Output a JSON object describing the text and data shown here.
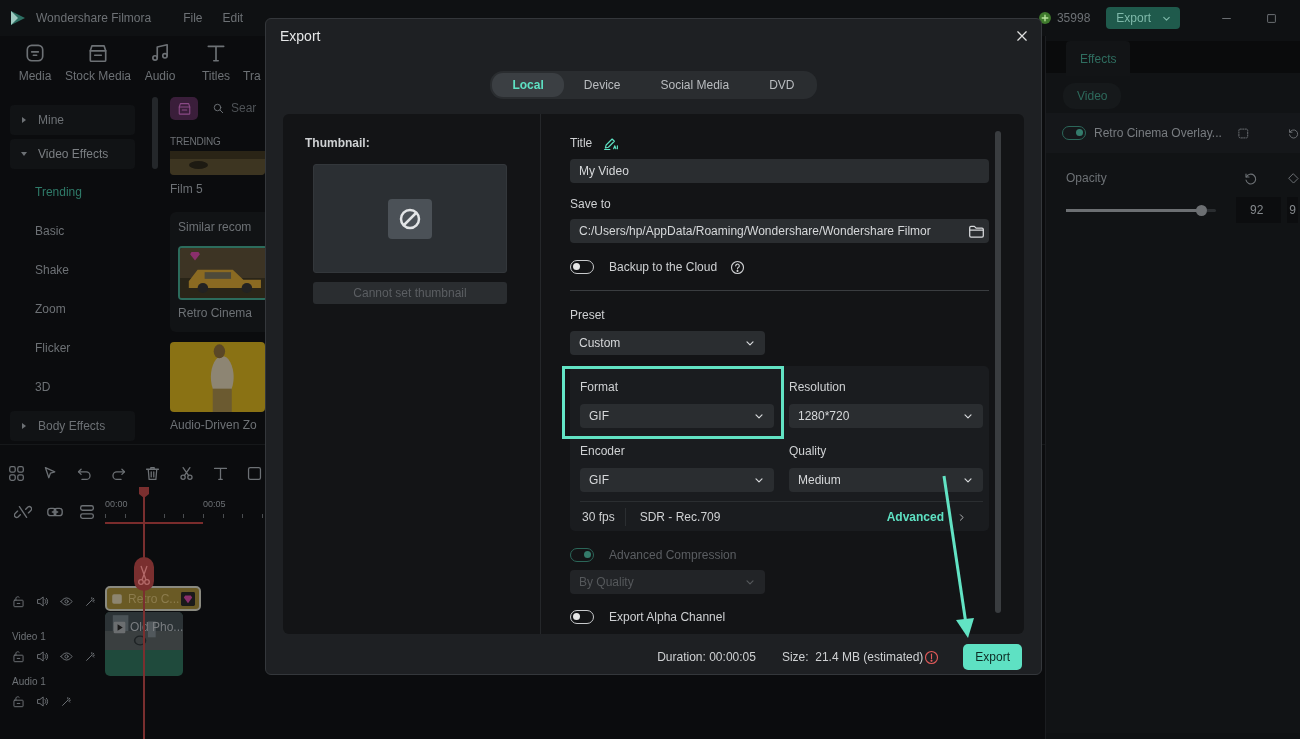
{
  "app": {
    "name": "Wondershare Filmora",
    "menu": [
      "File",
      "Edit"
    ],
    "coins": "35998",
    "export_button": "Export"
  },
  "toolbar": [
    {
      "label": "Media",
      "kind": "media"
    },
    {
      "label": "Stock Media",
      "kind": "store"
    },
    {
      "label": "Audio",
      "kind": "audio"
    },
    {
      "label": "Titles",
      "kind": "titles"
    },
    {
      "label": "Tra",
      "kind": "none"
    }
  ],
  "sidebar": {
    "items": [
      {
        "label": "Mine",
        "expanded": false
      },
      {
        "label": "Video Effects",
        "expanded": true,
        "children": [
          {
            "label": "Trending",
            "selected": true
          },
          {
            "label": "Basic",
            "selected": false
          },
          {
            "label": "Shake",
            "selected": false
          },
          {
            "label": "Zoom",
            "selected": false
          },
          {
            "label": "Flicker",
            "selected": false
          },
          {
            "label": "3D",
            "selected": false
          }
        ]
      },
      {
        "label": "Body Effects",
        "expanded": false
      }
    ]
  },
  "browser": {
    "search_placeholder": "Sear",
    "section": "TRENDING",
    "first_item": "Film 5",
    "similar_title": "Similar recom",
    "similar_item": {
      "label": "Retro Cinema",
      "selected": true
    },
    "last_item": "Audio-Driven Zo"
  },
  "timeline": {
    "ruler": [
      "00:00",
      "00:05"
    ],
    "tracks": [
      {
        "clip": "Retro C...",
        "kind": "effect"
      },
      {
        "label": "Video 1",
        "clip": "Old Pho...",
        "kind": "video"
      },
      {
        "label": "Audio 1",
        "kind": "audio"
      }
    ]
  },
  "properties": {
    "tab": "Effects",
    "chip": "Video",
    "effect": {
      "name": "Retro Cinema Overlay...",
      "on": true
    },
    "opacity": {
      "label": "Opacity",
      "level": 0.9,
      "value": "92",
      "value_2": "9"
    }
  },
  "dialog": {
    "title": "Export",
    "tabs": [
      {
        "label": "Local",
        "selected": true
      },
      {
        "label": "Device",
        "selected": false
      },
      {
        "label": "Social Media",
        "selected": false
      },
      {
        "label": "DVD",
        "selected": false
      }
    ],
    "thumbnail": {
      "label": "Thumbnail:",
      "button": "Cannot set thumbnail"
    },
    "title_field": {
      "label": "Title",
      "value": "My Video"
    },
    "save_to": {
      "label": "Save to",
      "value": "C:/Users/hp/AppData/Roaming/Wondershare/Wondershare Filmor"
    },
    "backup": {
      "label": "Backup to the Cloud",
      "on": false
    },
    "preset": {
      "label": "Preset",
      "value": "Custom"
    },
    "settings": [
      {
        "label": "Format",
        "value": "GIF",
        "highlighted": true
      },
      {
        "label": "Resolution",
        "value": "1280*720",
        "highlighted": false
      },
      {
        "label": "Encoder",
        "value": "GIF",
        "highlighted": false
      },
      {
        "label": "Quality",
        "value": "Medium",
        "highlighted": false
      }
    ],
    "fps": "30 fps",
    "color_space": "SDR - Rec.709",
    "advanced_link": "Advanced",
    "compression": {
      "label": "Advanced Compression",
      "on": true,
      "disabled": true,
      "mode": "By Quality"
    },
    "alpha": {
      "label": "Export Alpha Channel",
      "on": false
    },
    "duration": "Duration: 00:00:05",
    "size": "Size:  21.4 MB (estimated)",
    "export_button": "Export",
    "annotation_arrow": true
  }
}
